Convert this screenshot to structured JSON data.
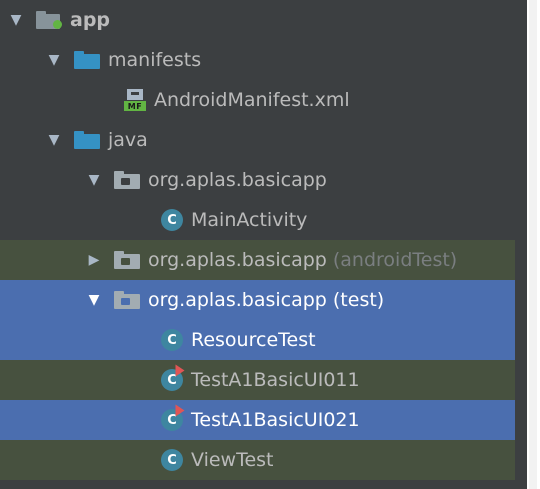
{
  "tree": [
    {
      "label": "app",
      "arrow": "▼",
      "icon": "module-folder-icon",
      "bold": true
    },
    {
      "label": "manifests",
      "arrow": "▼",
      "icon": "folder-icon"
    },
    {
      "label": "AndroidManifest.xml",
      "icon": "manifest-file-icon",
      "icon_badge": "MF"
    },
    {
      "label": "java",
      "arrow": "▼",
      "icon": "folder-icon"
    },
    {
      "label": "org.aplas.basicapp",
      "arrow": "▼",
      "icon": "package-icon"
    },
    {
      "label": "MainActivity",
      "icon": "class-icon",
      "icon_letter": "C"
    },
    {
      "label": "org.aplas.basicapp",
      "suffix": "(androidTest)",
      "arrow": "▶",
      "icon": "package-icon",
      "background": "#47513f"
    },
    {
      "label": "org.aplas.basicapp (test)",
      "arrow": "▼",
      "icon": "package-icon",
      "selected": true,
      "background": "#4b6eaf"
    },
    {
      "label": "ResourceTest",
      "icon": "class-icon",
      "icon_letter": "C",
      "selected": true,
      "background": "#4b6eaf"
    },
    {
      "label": "TestA1BasicUI011",
      "icon": "test-class-icon",
      "icon_letter": "C",
      "background": "#47513f"
    },
    {
      "label": "TestA1BasicUI021",
      "icon": "test-class-icon",
      "icon_letter": "C",
      "selected": true,
      "background": "#4b6eaf"
    },
    {
      "label": "ViewTest",
      "icon": "class-icon",
      "icon_letter": "C",
      "background": "#47513f"
    }
  ],
  "colors": {
    "panel_background": "#3c3f41",
    "selection": "#4b6eaf",
    "test_scope": "#47513f",
    "text": "#bbbbbb",
    "class_icon": "#3e86a0",
    "module_dot": "#62b543"
  }
}
